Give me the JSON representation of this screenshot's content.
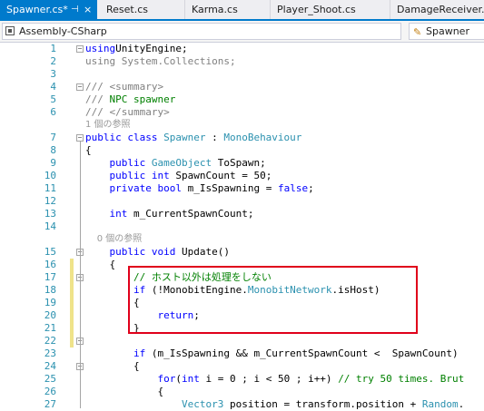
{
  "tabs": [
    {
      "label": "Spawner.cs*",
      "pin": "⊣",
      "close": "×",
      "active": true
    },
    {
      "label": "Reset.cs",
      "active": false
    },
    {
      "label": "Karma.cs",
      "active": false
    },
    {
      "label": "Player_Shoot.cs",
      "active": false
    },
    {
      "label": "DamageReceiver.cs",
      "active": false
    }
  ],
  "navbar": {
    "project": "Assembly-CSharp",
    "class": "Spawner"
  },
  "code_lines": [
    {
      "n": "1",
      "segs": [
        [
          "kw",
          "using"
        ],
        [
          "",
          "UnityEngine;"
        ]
      ]
    },
    {
      "n": "2",
      "segs": [
        [
          "gd",
          "using System.Collections;"
        ]
      ]
    },
    {
      "n": "3",
      "segs": []
    },
    {
      "n": "4",
      "segs": [
        [
          "gd",
          "/// <summary>"
        ]
      ]
    },
    {
      "n": "5",
      "segs": [
        [
          "gd",
          "/// "
        ],
        [
          "cm",
          "NPC spawner"
        ]
      ]
    },
    {
      "n": "6",
      "segs": [
        [
          "gd",
          "/// </summary>"
        ]
      ]
    },
    {
      "lens": "1 個の参照"
    },
    {
      "n": "7",
      "segs": [
        [
          "kw",
          "public class "
        ],
        [
          "ty",
          "Spawner"
        ],
        [
          "",
          " : "
        ],
        [
          "ty",
          "MonoBehaviour"
        ]
      ]
    },
    {
      "n": "8",
      "segs": [
        [
          "",
          "{"
        ]
      ]
    },
    {
      "n": "9",
      "segs": [
        [
          "",
          "    "
        ],
        [
          "kw",
          "public "
        ],
        [
          "ty",
          "GameObject"
        ],
        [
          "",
          " ToSpawn;"
        ]
      ]
    },
    {
      "n": "10",
      "segs": [
        [
          "",
          "    "
        ],
        [
          "kw",
          "public int"
        ],
        [
          "",
          " SpawnCount = 50;"
        ]
      ]
    },
    {
      "n": "11",
      "segs": [
        [
          "",
          "    "
        ],
        [
          "kw",
          "private bool"
        ],
        [
          "",
          " m_IsSpawning = "
        ],
        [
          "kw",
          "false"
        ],
        [
          "",
          ";"
        ]
      ]
    },
    {
      "n": "12",
      "segs": []
    },
    {
      "n": "13",
      "segs": [
        [
          "",
          "    "
        ],
        [
          "kw",
          "int"
        ],
        [
          "",
          " m_CurrentSpawnCount;"
        ]
      ]
    },
    {
      "n": "14",
      "segs": []
    },
    {
      "lens": "    0 個の参照"
    },
    {
      "n": "15",
      "segs": [
        [
          "",
          "    "
        ],
        [
          "kw",
          "public void"
        ],
        [
          "",
          " Update()"
        ]
      ]
    },
    {
      "n": "16",
      "segs": [
        [
          "",
          "    {"
        ]
      ]
    },
    {
      "n": "17",
      "segs": [
        [
          "",
          "        "
        ],
        [
          "cm",
          "// ホスト以外は処理をしない"
        ]
      ]
    },
    {
      "n": "18",
      "segs": [
        [
          "",
          "        "
        ],
        [
          "kw",
          "if"
        ],
        [
          "",
          " (!MonobitEngine."
        ],
        [
          "ty",
          "MonobitNetwork"
        ],
        [
          "",
          ".isHost)"
        ]
      ]
    },
    {
      "n": "19",
      "segs": [
        [
          "",
          "        {"
        ]
      ]
    },
    {
      "n": "20",
      "segs": [
        [
          "",
          "            "
        ],
        [
          "kw",
          "return"
        ],
        [
          "",
          ";"
        ]
      ]
    },
    {
      "n": "21",
      "segs": [
        [
          "",
          "        }"
        ]
      ]
    },
    {
      "n": "22",
      "segs": []
    },
    {
      "n": "23",
      "segs": [
        [
          "",
          "        "
        ],
        [
          "kw",
          "if"
        ],
        [
          "",
          " (m_IsSpawning && m_CurrentSpawnCount <  SpawnCount)"
        ]
      ]
    },
    {
      "n": "24",
      "segs": [
        [
          "",
          "        {"
        ]
      ]
    },
    {
      "n": "25",
      "segs": [
        [
          "",
          "            "
        ],
        [
          "kw",
          "for"
        ],
        [
          "",
          "("
        ],
        [
          "kw",
          "int"
        ],
        [
          "",
          " i = 0 ; i < 50 ; i++) "
        ],
        [
          "cm",
          "// try 50 times. Brut"
        ]
      ]
    },
    {
      "n": "26",
      "segs": [
        [
          "",
          "            {"
        ]
      ]
    },
    {
      "n": "27",
      "segs": [
        [
          "",
          "                "
        ],
        [
          "ty",
          "Vector3"
        ],
        [
          "",
          " position = transform.position + "
        ],
        [
          "ty",
          "Random"
        ],
        [
          "",
          "."
        ]
      ]
    }
  ]
}
